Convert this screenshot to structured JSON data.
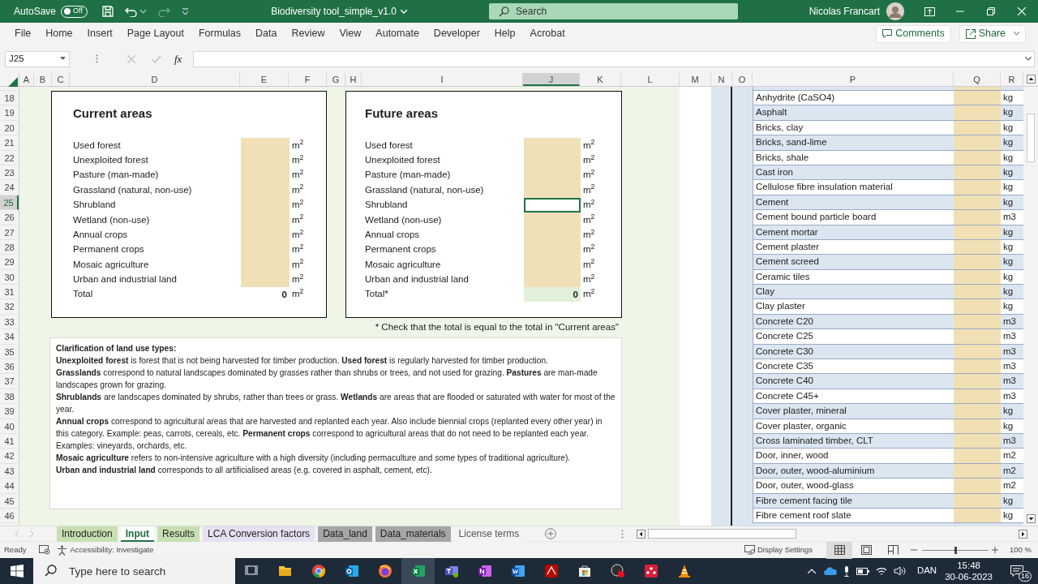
{
  "window": {
    "title": "Biodiversity tool_simple_v1.0",
    "autosave": {
      "label": "AutoSave",
      "on": false,
      "state_text": "Off"
    },
    "search": {
      "placeholder": "Search"
    },
    "user": "Nicolas Francart"
  },
  "ribbon_tabs": [
    "File",
    "Home",
    "Insert",
    "Page Layout",
    "Formulas",
    "Data",
    "Review",
    "View",
    "Automate",
    "Developer",
    "Help",
    "Acrobat"
  ],
  "ribbon_buttons": {
    "comments": "Comments",
    "share": "Share"
  },
  "formula_bar": {
    "name_box": "J25",
    "fx": "fx"
  },
  "column_headers": [
    {
      "label": "A",
      "selected": false
    },
    {
      "label": "B",
      "selected": false
    },
    {
      "label": "C",
      "selected": false
    },
    {
      "label": "D",
      "selected": false
    },
    {
      "label": "E",
      "selected": false
    },
    {
      "label": "F",
      "selected": false
    },
    {
      "label": "G",
      "selected": false
    },
    {
      "label": "H",
      "selected": false
    },
    {
      "label": "I",
      "selected": false
    },
    {
      "label": "J",
      "selected": true
    },
    {
      "label": "K",
      "selected": false
    },
    {
      "label": "L",
      "selected": false
    },
    {
      "label": "M",
      "selected": false
    },
    {
      "label": "N",
      "selected": false
    },
    {
      "label": "O",
      "selected": false
    },
    {
      "label": "P",
      "selected": false
    },
    {
      "label": "Q",
      "selected": false
    },
    {
      "label": "R",
      "selected": false
    }
  ],
  "row_headers": [
    {
      "label": "18",
      "selected": false
    },
    {
      "label": "19",
      "selected": false
    },
    {
      "label": "20",
      "selected": false
    },
    {
      "label": "21",
      "selected": false
    },
    {
      "label": "22",
      "selected": false
    },
    {
      "label": "23",
      "selected": false
    },
    {
      "label": "24",
      "selected": false
    },
    {
      "label": "25",
      "selected": true
    },
    {
      "label": "26",
      "selected": false
    },
    {
      "label": "27",
      "selected": false
    },
    {
      "label": "28",
      "selected": false
    },
    {
      "label": "29",
      "selected": false
    },
    {
      "label": "30",
      "selected": false
    },
    {
      "label": "31",
      "selected": false
    },
    {
      "label": "32",
      "selected": false
    },
    {
      "label": "33",
      "selected": false
    },
    {
      "label": "34",
      "selected": false
    },
    {
      "label": "35",
      "selected": false
    },
    {
      "label": "36",
      "selected": false
    },
    {
      "label": "37",
      "selected": false
    },
    {
      "label": "38",
      "selected": false
    },
    {
      "label": "39",
      "selected": false
    },
    {
      "label": "40",
      "selected": false
    },
    {
      "label": "41",
      "selected": false
    },
    {
      "label": "42",
      "selected": false
    },
    {
      "label": "43",
      "selected": false
    },
    {
      "label": "44",
      "selected": false
    },
    {
      "label": "45",
      "selected": false
    },
    {
      "label": "46",
      "selected": false
    }
  ],
  "current_areas": {
    "title": "Current areas",
    "items": [
      {
        "label": "Used forest",
        "unit": "m$^{2}$"
      },
      {
        "label": "Unexploited forest",
        "unit": "m$^{2}$"
      },
      {
        "label": "Pasture (man-made)",
        "unit": "m$^{2}$"
      },
      {
        "label": "Grassland (natural, non-use)",
        "unit": "m$^{2}$"
      },
      {
        "label": "Shrubland",
        "unit": "m$^{2}$"
      },
      {
        "label": "Wetland (non-use)",
        "unit": "m$^{2}$"
      },
      {
        "label": "Annual crops",
        "unit": "m$^{2}$"
      },
      {
        "label": "Permanent crops",
        "unit": "m$^{2}$"
      },
      {
        "label": "Mosaic agriculture",
        "unit": "m$^{2}$"
      },
      {
        "label": "Urban and industrial land",
        "unit": "m$^{2}$"
      }
    ],
    "total": {
      "label": "Total",
      "value": "0",
      "unit": "m$^{2}$"
    }
  },
  "future_areas": {
    "title": "Future areas",
    "items": [
      {
        "label": "Used forest",
        "unit": "m$^{2}$",
        "selected": false
      },
      {
        "label": "Unexploited forest",
        "unit": "m$^{2}$",
        "selected": false
      },
      {
        "label": "Pasture (man-made)",
        "unit": "m$^{2}$",
        "selected": false
      },
      {
        "label": "Grassland (natural, non-use)",
        "unit": "m$^{2}$",
        "selected": false
      },
      {
        "label": "Shrubland",
        "unit": "m$^{2}$",
        "selected": true
      },
      {
        "label": "Wetland (non-use)",
        "unit": "m$^{2}$",
        "selected": false
      },
      {
        "label": "Annual crops",
        "unit": "m$^{2}$",
        "selected": false
      },
      {
        "label": "Permanent crops",
        "unit": "m$^{2}$",
        "selected": false
      },
      {
        "label": "Mosaic agriculture",
        "unit": "m$^{2}$",
        "selected": false
      },
      {
        "label": "Urban and industrial land",
        "unit": "m$^{2}$",
        "selected": false
      }
    ],
    "total": {
      "label": "Total*",
      "value": "0",
      "unit": "m$^{2}$"
    },
    "note": "* Check that the total is equal to the total in \"Current areas\""
  },
  "clarification": {
    "heading": "Clarification of land use types:",
    "paragraphs": [
      "**Unexploited forest** is forest that is not being harvested for timber production. **Used forest** is regularly harvested for timber production.",
      "**Grasslands** correspond to natural landscapes dominated by grasses rather than shrubs or trees, and not used for grazing. **Pastures** are man-made landscapes grown for grazing.",
      "**Shrublands** are landscapes dominated by shrubs, rather than trees or grass. **Wetlands** are areas that are flooded or saturated with water for most of the year.",
      "**Annual crops** correspond to agricultural areas that are harvested and replanted each year. Also include biennial crops (replanted every other year) in this category. Example: peas, carrots, cereals, etc. **Permanent crops** correspond to agricultural areas that do not need to be replanted each year. Examples: vineyards, orchards, etc.",
      "**Mosaic agriculture** refers to non-intensive agriculture with a high diversity (including permaculture and some types of traditional agriculture).",
      "**Urban and industrial land** corresponds to all artificialised areas (e.g. covered in asphalt, cement, etc)."
    ]
  },
  "materials": [
    {
      "name": "Anhydrite (CaSO4)",
      "unit": "kg"
    },
    {
      "name": "Asphalt",
      "unit": "kg"
    },
    {
      "name": "Bricks, clay",
      "unit": "kg"
    },
    {
      "name": "Bricks, sand-lime",
      "unit": "kg"
    },
    {
      "name": "Bricks, shale",
      "unit": "kg"
    },
    {
      "name": "Cast iron",
      "unit": "kg"
    },
    {
      "name": "Cellulose fibre insulation material",
      "unit": "kg"
    },
    {
      "name": "Cement",
      "unit": "kg"
    },
    {
      "name": "Cement bound particle board",
      "unit": "m3"
    },
    {
      "name": "Cement mortar",
      "unit": "kg"
    },
    {
      "name": "Cement plaster",
      "unit": "kg"
    },
    {
      "name": "Cement screed",
      "unit": "kg"
    },
    {
      "name": "Ceramic tiles",
      "unit": "kg"
    },
    {
      "name": "Clay",
      "unit": "kg"
    },
    {
      "name": "Clay plaster",
      "unit": "kg"
    },
    {
      "name": "Concrete C20",
      "unit": "m3"
    },
    {
      "name": "Concrete C25",
      "unit": "m3"
    },
    {
      "name": "Concrete C30",
      "unit": "m3"
    },
    {
      "name": "Concrete C35",
      "unit": "m3"
    },
    {
      "name": "Concrete C40",
      "unit": "m3"
    },
    {
      "name": "Concrete C45+",
      "unit": "m3"
    },
    {
      "name": "Cover plaster, mineral",
      "unit": "kg"
    },
    {
      "name": "Cover plaster, organic",
      "unit": "kg"
    },
    {
      "name": "Cross laminated timber, CLT",
      "unit": "m3"
    },
    {
      "name": "Door, inner, wood",
      "unit": "m2"
    },
    {
      "name": "Door, outer, wood-aluminium",
      "unit": "m2"
    },
    {
      "name": "Door, outer, wood-glass",
      "unit": "m2"
    },
    {
      "name": "Fibre cement facing tile",
      "unit": "kg"
    },
    {
      "name": "Fibre cement roof slate",
      "unit": "kg"
    }
  ],
  "sheet_tabs": [
    {
      "label": "Introduction",
      "selected": false,
      "color": "#c6e0b4"
    },
    {
      "label": "Input",
      "selected": true,
      "color": "#ffffff"
    },
    {
      "label": "Results",
      "selected": false,
      "color": "#c6e0b4"
    },
    {
      "label": "LCA Conversion factors",
      "selected": false,
      "color": "#e6e0f2"
    },
    {
      "label": "Data_land",
      "selected": false,
      "color": "#a6a6a6"
    },
    {
      "label": "Data_materials",
      "selected": false,
      "color": "#a6a6a6"
    },
    {
      "label": "License terms",
      "selected": false,
      "color": "#f3f3f3"
    }
  ],
  "status_bar": {
    "ready": "Ready",
    "accessibility": "Accessibility: Investigate",
    "display_settings": "Display Settings",
    "zoom": "100 %",
    "level": 0.5
  },
  "taskbar": {
    "search": {
      "placeholder": "Type here to search"
    },
    "language": "DAN",
    "time": "15:48",
    "date": "30-06-2023",
    "notifications": "16"
  }
}
